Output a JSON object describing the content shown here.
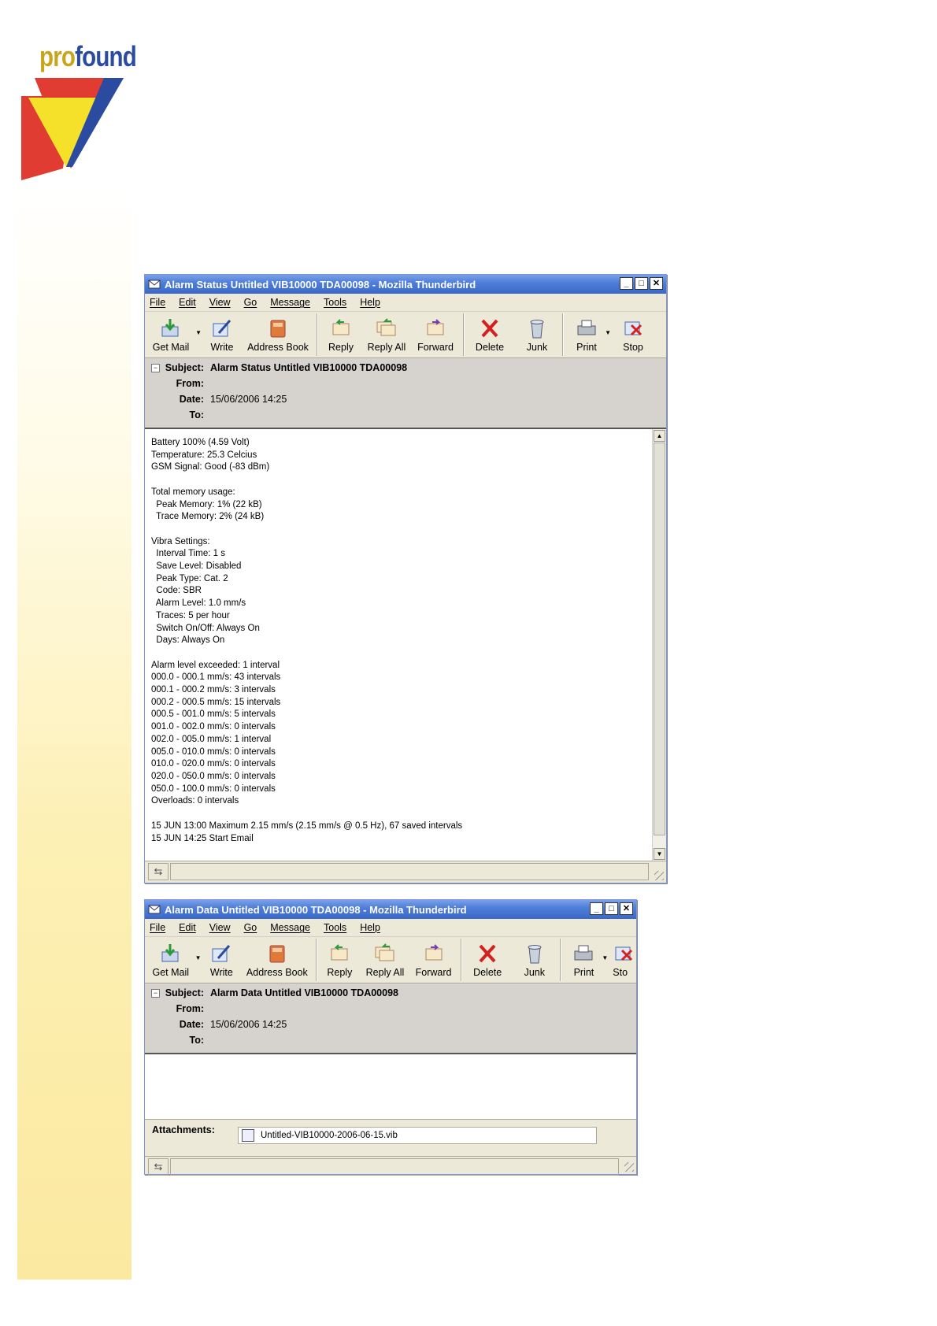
{
  "brand": {
    "logo_part1": "pro",
    "logo_part2": "found"
  },
  "menu": [
    "File",
    "Edit",
    "View",
    "Go",
    "Message",
    "Tools",
    "Help"
  ],
  "toolbar": {
    "get_mail": "Get Mail",
    "write": "Write",
    "address_book": "Address Book",
    "reply": "Reply",
    "reply_all": "Reply All",
    "forward": "Forward",
    "delete": "Delete",
    "junk": "Junk",
    "print": "Print",
    "stop": "Stop",
    "stop_truncated": "Sto"
  },
  "header_labels": {
    "subject": "Subject:",
    "from": "From:",
    "date": "Date:",
    "to": "To:"
  },
  "window1": {
    "title": "Alarm Status Untitled VIB10000 TDA00098 - Mozilla Thunderbird",
    "subject": "Alarm Status Untitled VIB10000 TDA00098",
    "from": "",
    "date": "15/06/2006 14:25",
    "to": "",
    "body_lines": [
      "Battery 100% (4.59 Volt)",
      "Temperature: 25.3 Celcius",
      "GSM Signal: Good (-83 dBm)",
      "",
      "Total memory usage:",
      "  Peak Memory: 1% (22 kB)",
      "  Trace Memory: 2% (24 kB)",
      "",
      "Vibra Settings:",
      "  Interval Time: 1 s",
      "  Save Level: Disabled",
      "  Peak Type: Cat. 2",
      "  Code: SBR",
      "  Alarm Level: 1.0 mm/s",
      "  Traces: 5 per hour",
      "  Switch On/Off: Always On",
      "  Days: Always On",
      "",
      "Alarm level exceeded: 1 interval",
      "000.0 - 000.1 mm/s: 43 intervals",
      "000.1 - 000.2 mm/s: 3 intervals",
      "000.2 - 000.5 mm/s: 15 intervals",
      "000.5 - 001.0 mm/s: 5 intervals",
      "001.0 - 002.0 mm/s: 0 intervals",
      "002.0 - 005.0 mm/s: 1 interval",
      "005.0 - 010.0 mm/s: 0 intervals",
      "010.0 - 020.0 mm/s: 0 intervals",
      "020.0 - 050.0 mm/s: 0 intervals",
      "050.0 - 100.0 mm/s: 0 intervals",
      "Overloads: 0 intervals",
      "",
      "15 JUN 13:00 Maximum 2.15 mm/s (2.15 mm/s @ 0.5 Hz), 67 saved intervals",
      "15 JUN 14:25 Start Email"
    ]
  },
  "window2": {
    "title": "Alarm Data Untitled VIB10000 TDA00098 - Mozilla Thunderbird",
    "subject": "Alarm Data Untitled VIB10000 TDA00098",
    "from": "",
    "date": "15/06/2006 14:25",
    "to": "",
    "attachments_label": "Attachments:",
    "attachment_file": "Untitled-VIB10000-2006-06-15.vib"
  },
  "colors": {
    "titlebar": "#3a68c8",
    "chrome": "#ece9d8",
    "header_pane": "#d6d3ce",
    "logo_blue": "#2b4ba0",
    "logo_gold": "#c9a51c",
    "logo_red": "#e03c31",
    "logo_yellow": "#f5e12a"
  }
}
